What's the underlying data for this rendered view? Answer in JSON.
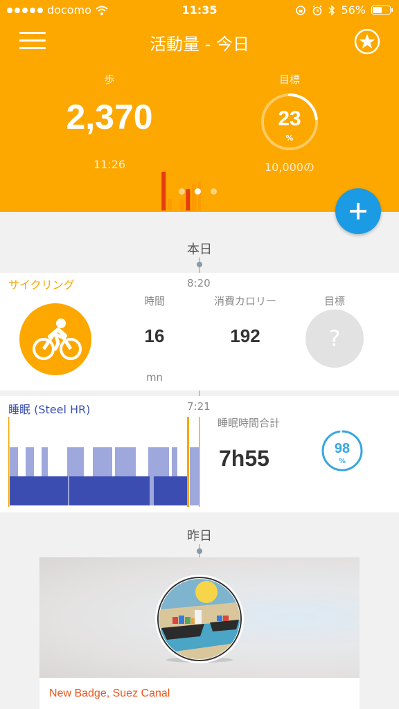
{
  "status_bar": {
    "carrier": "docomo",
    "time": "11:35",
    "battery": "56%",
    "battery_level": 0.56
  },
  "header": {
    "title": "活動量 - 今日",
    "steps_label": "歩",
    "steps_value": "2,370",
    "steps_time": "11:26",
    "goal_label": "目標",
    "goal_percent": "23",
    "goal_percent_unit": "%",
    "goal_fraction": 0.23,
    "goal_target": "10,000の",
    "accent_color": "#fda800"
  },
  "icons": {
    "menu": "menu-icon",
    "star": "star-badge-icon",
    "add": "plus-icon",
    "cycling": "bicycle-icon"
  },
  "activity_chart": {
    "bars": [
      0,
      0,
      0,
      0,
      0,
      0,
      0,
      0,
      0,
      0,
      0,
      0,
      0,
      0,
      0,
      0,
      0,
      0,
      0,
      0,
      0,
      0,
      0,
      0,
      1.0,
      0.3,
      0,
      0.3,
      0.55,
      0.68,
      0.75,
      0.5
    ],
    "bar_colors": [
      "#ff9a00",
      "#e83b0f"
    ]
  },
  "today": {
    "section_label": "本日",
    "cycling": {
      "title": "サイクリング",
      "time": "8:20",
      "duration_label": "時間",
      "duration_value": "16",
      "duration_unit": "mn",
      "calories_label": "消費カロリー",
      "calories_value": "192",
      "goal_label": "目標",
      "goal_value": "?"
    },
    "sleep": {
      "title": "睡眠 (Steel HR)",
      "time": "7:21",
      "total_label": "睡眠時間合計",
      "total_value": "7h55",
      "score": "98",
      "score_unit": "%",
      "score_fraction": 0.98,
      "light_color": "#9ea8dc",
      "deep_color": "#3c4db2",
      "marker_color": "#f5a800"
    }
  },
  "yesterday": {
    "section_label": "昨日",
    "badge_title": "New Badge, Suez Canal"
  }
}
